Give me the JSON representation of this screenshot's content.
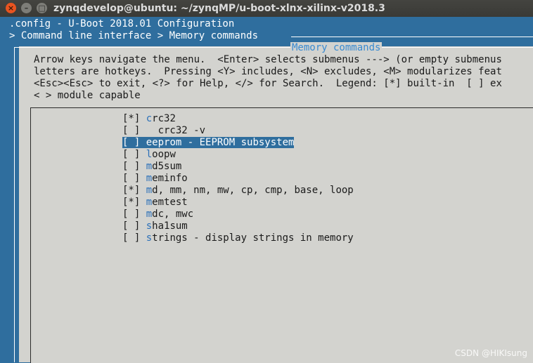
{
  "window": {
    "title": "zynqdevelop@ubuntu: ~/zynqMP/u-boot-xlnx-xilinx-v2018.3",
    "close_glyph": "×",
    "min_glyph": "–",
    "max_glyph": "□"
  },
  "header": {
    "config_line": ".config - U-Boot 2018.01 Configuration",
    "breadcrumb": "> Command line interface > Memory commands"
  },
  "dialog": {
    "title": "Memory commands",
    "help_lines": [
      "Arrow keys navigate the menu.  <Enter> selects submenus ---> (or empty submenus",
      "letters are hotkeys.  Pressing <Y> includes, <N> excludes, <M> modularizes feat",
      "<Esc><Esc> to exit, <?> for Help, </> for Search.  Legend: [*] built-in  [ ] ex",
      "< > module capable"
    ]
  },
  "menu": {
    "items": [
      {
        "mark": "[*] ",
        "indent": "",
        "hotkey": "c",
        "rest": "rc32"
      },
      {
        "mark": "[ ] ",
        "indent": "  ",
        "hotkey": "",
        "rest": "crc32 -v"
      },
      {
        "mark": "[ ] ",
        "indent": "",
        "hotkey": "e",
        "rest": "eprom - EEPROM subsystem"
      },
      {
        "mark": "[ ] ",
        "indent": "",
        "hotkey": "l",
        "rest": "oopw"
      },
      {
        "mark": "[ ] ",
        "indent": "",
        "hotkey": "m",
        "rest": "d5sum"
      },
      {
        "mark": "[ ] ",
        "indent": "",
        "hotkey": "m",
        "rest": "eminfo"
      },
      {
        "mark": "[*] ",
        "indent": "",
        "hotkey": "m",
        "rest": "d, mm, nm, mw, cp, cmp, base, loop"
      },
      {
        "mark": "[*] ",
        "indent": "",
        "hotkey": "m",
        "rest": "emtest"
      },
      {
        "mark": "[ ] ",
        "indent": "",
        "hotkey": "m",
        "rest": "dc, mwc"
      },
      {
        "mark": "[ ] ",
        "indent": "",
        "hotkey": "s",
        "rest": "ha1sum"
      },
      {
        "mark": "[ ] ",
        "indent": "",
        "hotkey": "s",
        "rest": "trings - display strings in memory"
      }
    ]
  },
  "watermark": "CSDN @HIKIsung",
  "colors": {
    "terminal_bg": "#2f6e9e",
    "dialog_bg": "#d3d3cf",
    "hotkey": "#2a6fb8",
    "selection_bg": "#2f6e9e"
  }
}
